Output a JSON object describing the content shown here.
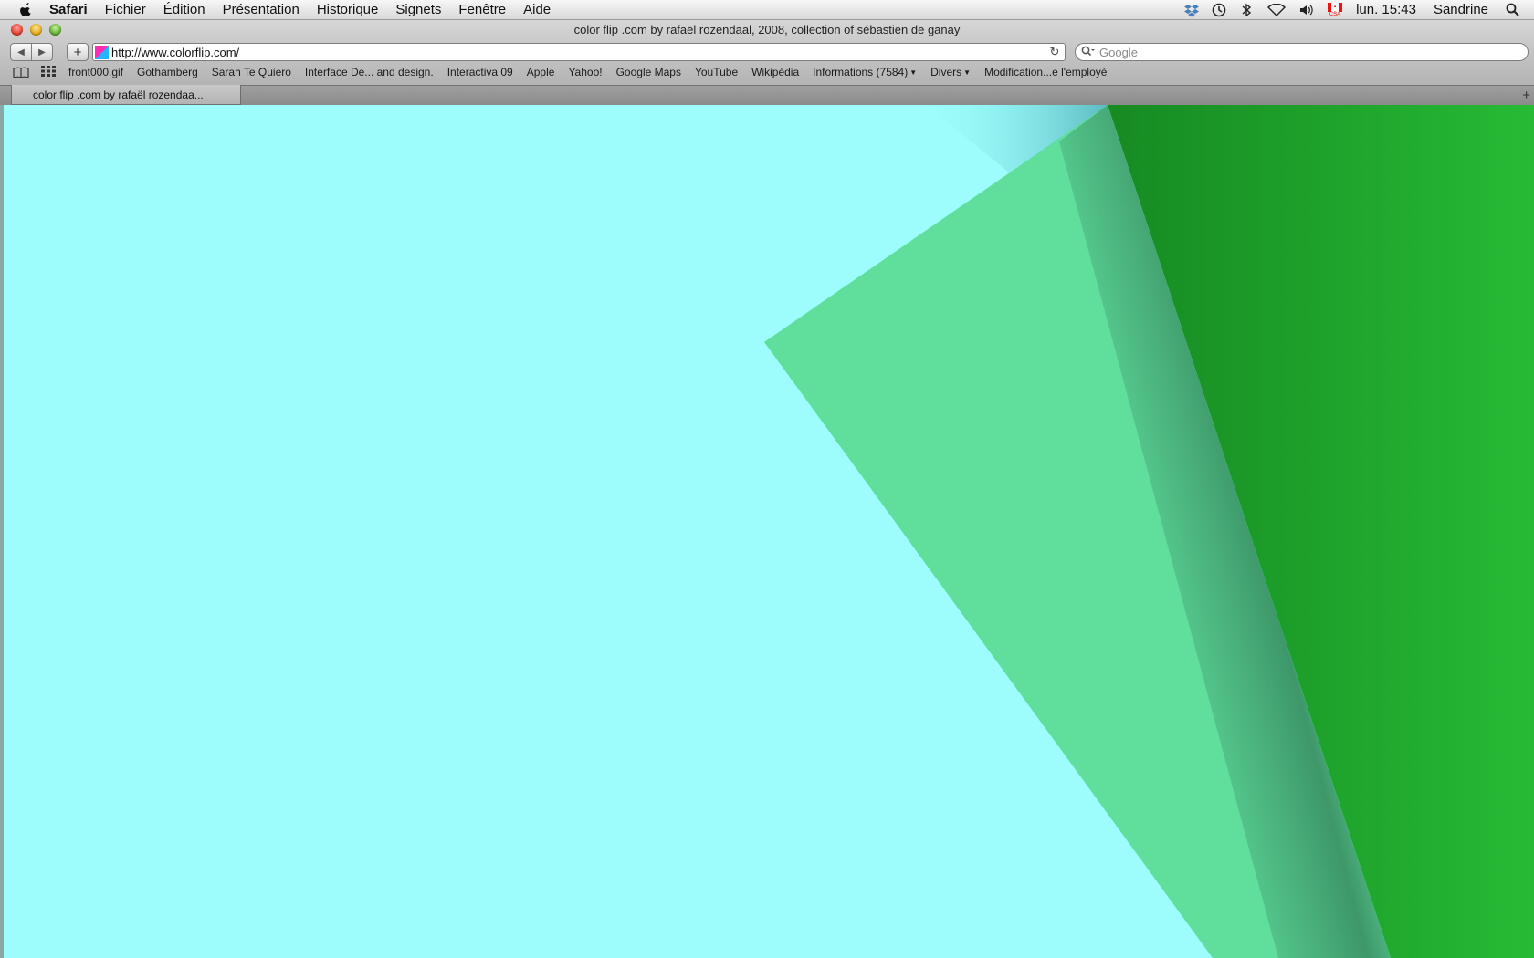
{
  "menubar": {
    "app_name": "Safari",
    "menus": [
      "Fichier",
      "Édition",
      "Présentation",
      "Historique",
      "Signets",
      "Fenêtre",
      "Aide"
    ],
    "status_icons": [
      "dropbox-icon",
      "time-machine-icon",
      "bluetooth-icon",
      "wifi-icon",
      "volume-icon"
    ],
    "input_flag_label": "CSA",
    "clock": "lun. 15:43",
    "user": "Sandrine"
  },
  "window": {
    "title": "color flip .com by rafaël rozendaal, 2008, collection of sébastien de ganay"
  },
  "toolbar": {
    "url": "http://www.colorflip.com/",
    "search_placeholder": "Google"
  },
  "bookmarks": [
    {
      "label": "front000.gif"
    },
    {
      "label": "Gothamberg"
    },
    {
      "label": "Sarah Te Quiero"
    },
    {
      "label": "Interface De... and design."
    },
    {
      "label": "Interactiva 09"
    },
    {
      "label": "Apple"
    },
    {
      "label": "Yahoo!"
    },
    {
      "label": "Google Maps"
    },
    {
      "label": "YouTube"
    },
    {
      "label": "Wikipédia"
    },
    {
      "label": "Informations (7584)",
      "menu": true
    },
    {
      "label": "Divers",
      "menu": true
    },
    {
      "label": "Modification...e l'employé"
    }
  ],
  "tabs": [
    {
      "label": "color flip .com by rafaël rozendaa...",
      "active": true
    }
  ],
  "content": {
    "background_color": "#9cfdfc",
    "flap_color": "#5fdf9b",
    "revealed_color": "#23b832"
  }
}
